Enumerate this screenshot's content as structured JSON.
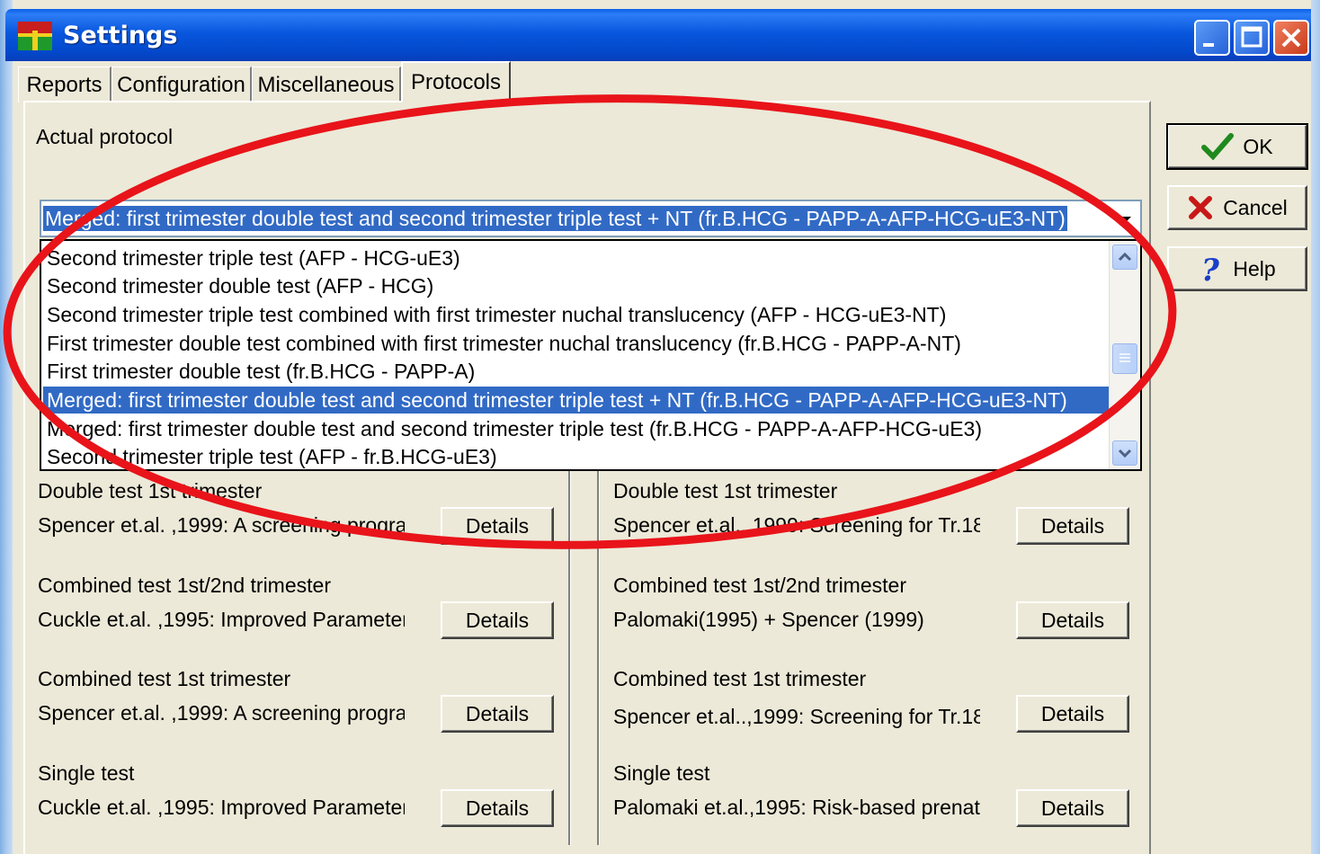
{
  "window": {
    "title": "Settings"
  },
  "tabs": [
    {
      "label": "Reports"
    },
    {
      "label": "Configuration"
    },
    {
      "label": "Miscellaneous"
    },
    {
      "label": "Protocols"
    }
  ],
  "protocols": {
    "actual_protocol_label": "Actual protocol",
    "selected_value": "Merged: first  trimester double test and second trimester triple test + NT (fr.B.HCG - PAPP-A-AFP-HCG-uE3-NT)",
    "options": [
      "Second trimester triple test (AFP - HCG-uE3)",
      "Second trimester double test (AFP - HCG)",
      "Second trimester triple test combined with first trimester nuchal translucency (AFP - HCG-uE3-NT)",
      "First trimester double test combined with first trimester nuchal translucency (fr.B.HCG - PAPP-A-NT)",
      "First trimester double test (fr.B.HCG - PAPP-A)",
      "Merged: first  trimester double test and second trimester triple test + NT (fr.B.HCG - PAPP-A-AFP-HCG-uE3-NT)",
      "Merged: first trimester double test and second trimester triple test (fr.B.HCG - PAPP-A-AFP-HCG-uE3)",
      "Second trimester triple test (AFP - fr.B.HCG-uE3)"
    ]
  },
  "left_column": [
    {
      "title": "Double test 1st trimester",
      "ref": "Spencer et.al. ,1999: A screening prograı",
      "button": "Details"
    },
    {
      "title": "Combined test 1st/2nd trimester",
      "ref": "Cuckle et.al. ,1995: Improved Parameter:",
      "button": "Details"
    },
    {
      "title": "Combined test 1st trimester",
      "ref": "Spencer et.al. ,1999: A screening prograı",
      "button": "Details"
    },
    {
      "title": "Single test",
      "ref": "Cuckle et.al. ,1995: Improved Parameter:",
      "button": "Details"
    }
  ],
  "right_column": [
    {
      "title": "Double test 1st trimester",
      "ref": "Spencer et.al..,1999: Screening for Tr.18",
      "button": "Details"
    },
    {
      "title": "Combined test 1st/2nd trimester",
      "ref": "Palomaki(1995) + Spencer (1999)",
      "button": "Details"
    },
    {
      "title": "Combined test 1st trimester",
      "ref": "Spencer et.al..,1999: Screening for Tr.18",
      "button": "Details"
    },
    {
      "title": "Single test",
      "ref": "Palomaki et.al.,1995: Risk-based prenata",
      "button": "Details"
    }
  ],
  "side_buttons": {
    "ok": "OK",
    "cancel": "Cancel",
    "help": "Help"
  },
  "colors": {
    "titlebar": "#0857de",
    "selection": "#316ac5",
    "dialog_bg": "#ece9d8",
    "annotation": "#e8141a"
  }
}
